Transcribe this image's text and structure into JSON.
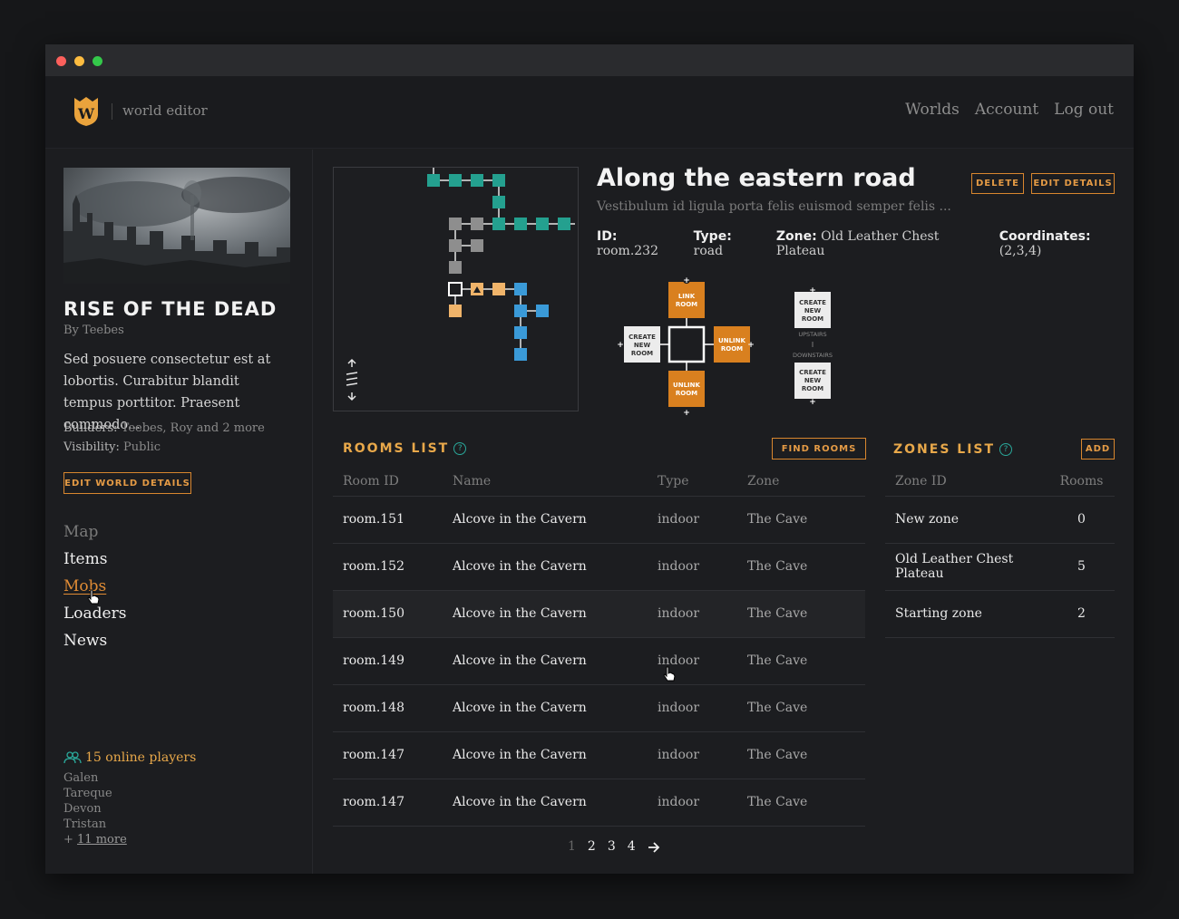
{
  "window": {
    "traffic_lights": [
      "close",
      "minimize",
      "maximize"
    ]
  },
  "header": {
    "logo_letter": "W",
    "brand_label": "world editor",
    "nav": [
      "Worlds",
      "Account",
      "Log out"
    ]
  },
  "world": {
    "title": "RISE OF THE DEAD",
    "author": "By Teebes",
    "description": "Sed posuere consectetur est at lobortis. Curabitur blandit tempus porttitor. Praesent commodo...",
    "builders_label": "Builders:",
    "builders_value": "Teebes, Roy and 2 more",
    "visibility_label": "Visibility:",
    "visibility_value": "Public",
    "edit_button": "EDIT WORLD DETAILS"
  },
  "sidenav": {
    "items": [
      {
        "label": "Map",
        "state": "dim"
      },
      {
        "label": "Items",
        "state": "normal"
      },
      {
        "label": "Mobs",
        "state": "active"
      },
      {
        "label": "Loaders",
        "state": "normal"
      },
      {
        "label": "News",
        "state": "normal"
      }
    ]
  },
  "online": {
    "heading": "15 online players",
    "players": [
      "Galen",
      "Tareque",
      "Devon",
      "Tristan"
    ],
    "more_prefix": "+ ",
    "more_link": "11 more"
  },
  "room": {
    "title": "Along the eastern road",
    "subtitle": "Vestibulum id ligula porta felis euismod semper felis ...",
    "id_label": "ID:",
    "id_value": "room.232",
    "type_label": "Type:",
    "type_value": "road",
    "zone_label": "Zone:",
    "zone_value": "Old Leather Chest Plateau",
    "coords_label": "Coordinates:",
    "coords_value": "(2,3,4)",
    "delete_button": "DELETE",
    "edit_button": "EDIT DETAILS"
  },
  "editor": {
    "north_label": [
      "LINK",
      "ROOM"
    ],
    "east_label": [
      "UNLINK",
      "ROOM"
    ],
    "south_label": [
      "UNLINK",
      "ROOM"
    ],
    "west_label": [
      "CREATE",
      "NEW",
      "ROOM"
    ],
    "up_label": [
      "CREATE",
      "NEW",
      "ROOM"
    ],
    "down_label": [
      "CREATE",
      "NEW",
      "ROOM"
    ],
    "upstairs": "UPSTAIRS",
    "downstairs": "DOWNSTAIRS",
    "orange": "#d9801f"
  },
  "rooms_list": {
    "title": "ROOMS LIST",
    "find_button": "FIND ROOMS",
    "columns": [
      "Room ID",
      "Name",
      "Type",
      "Zone"
    ],
    "rows": [
      [
        "room.151",
        "Alcove in the Cavern",
        "indoor",
        "The Cave"
      ],
      [
        "room.152",
        "Alcove in the Cavern",
        "indoor",
        "The Cave"
      ],
      [
        "room.150",
        "Alcove in the Cavern",
        "indoor",
        "The Cave"
      ],
      [
        "room.149",
        "Alcove in the Cavern",
        "indoor",
        "The Cave"
      ],
      [
        "room.148",
        "Alcove in the Cavern",
        "indoor",
        "The Cave"
      ],
      [
        "room.147",
        "Alcove in the Cavern",
        "indoor",
        "The Cave"
      ],
      [
        "room.147",
        "Alcove in the Cavern",
        "indoor",
        "The Cave"
      ]
    ],
    "highlighted_row": 2
  },
  "zones_list": {
    "title": "ZONES LIST",
    "add_button": "ADD",
    "columns": [
      "Zone ID",
      "Rooms"
    ],
    "rows": [
      [
        "New zone",
        "0"
      ],
      [
        "Old Leather Chest Plateau",
        "5"
      ],
      [
        "Starting zone",
        "2"
      ]
    ]
  },
  "pagination": {
    "pages": [
      "1",
      "2",
      "3",
      "4"
    ],
    "current": "1",
    "next_icon": "arrow-right-icon"
  },
  "colors": {
    "accent": "#e08c35",
    "teal": "#24a08f",
    "blue": "#3a9ad8",
    "grey": "#8e8e8e",
    "tan": "#f0b46a"
  }
}
